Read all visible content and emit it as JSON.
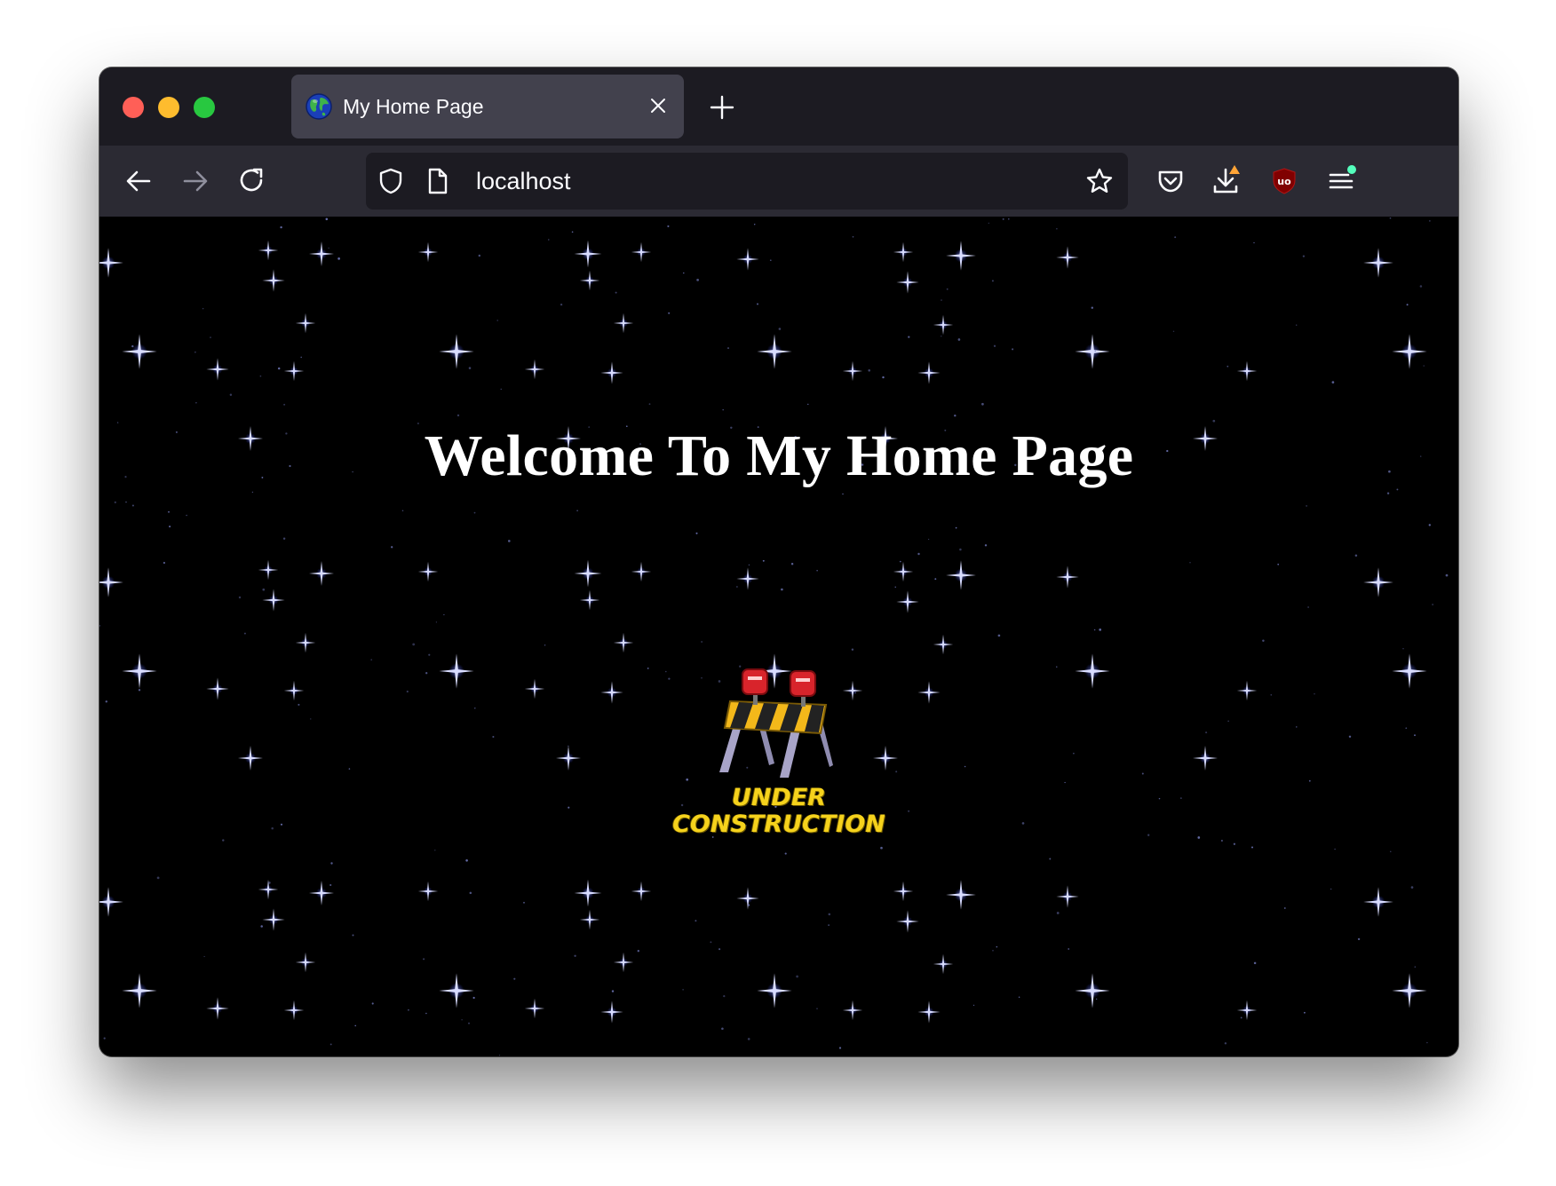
{
  "window": {
    "tab": {
      "title": "My Home Page",
      "favicon": "globe-icon"
    },
    "address_bar": {
      "url": "localhost"
    },
    "toolbar_icons": [
      "back-icon",
      "forward-icon",
      "reload-icon",
      "shield-icon",
      "page-icon",
      "bookmark-star-icon",
      "pocket-icon",
      "download-icon",
      "ublock-icon",
      "menu-icon"
    ]
  },
  "page": {
    "heading": "Welcome To My Home Page",
    "construction_line1": "UNDER",
    "construction_line2": "CONSTRUCTION",
    "background": "starfield"
  },
  "colors": {
    "tab_active": "#42414d",
    "chrome_dark": "#1c1b22",
    "toolbar": "#2b2a33",
    "download_badge": "#ffa436",
    "menu_badge": "#54ffbd",
    "ublock_red": "#800000",
    "construction_yellow": "#f5d21c"
  }
}
